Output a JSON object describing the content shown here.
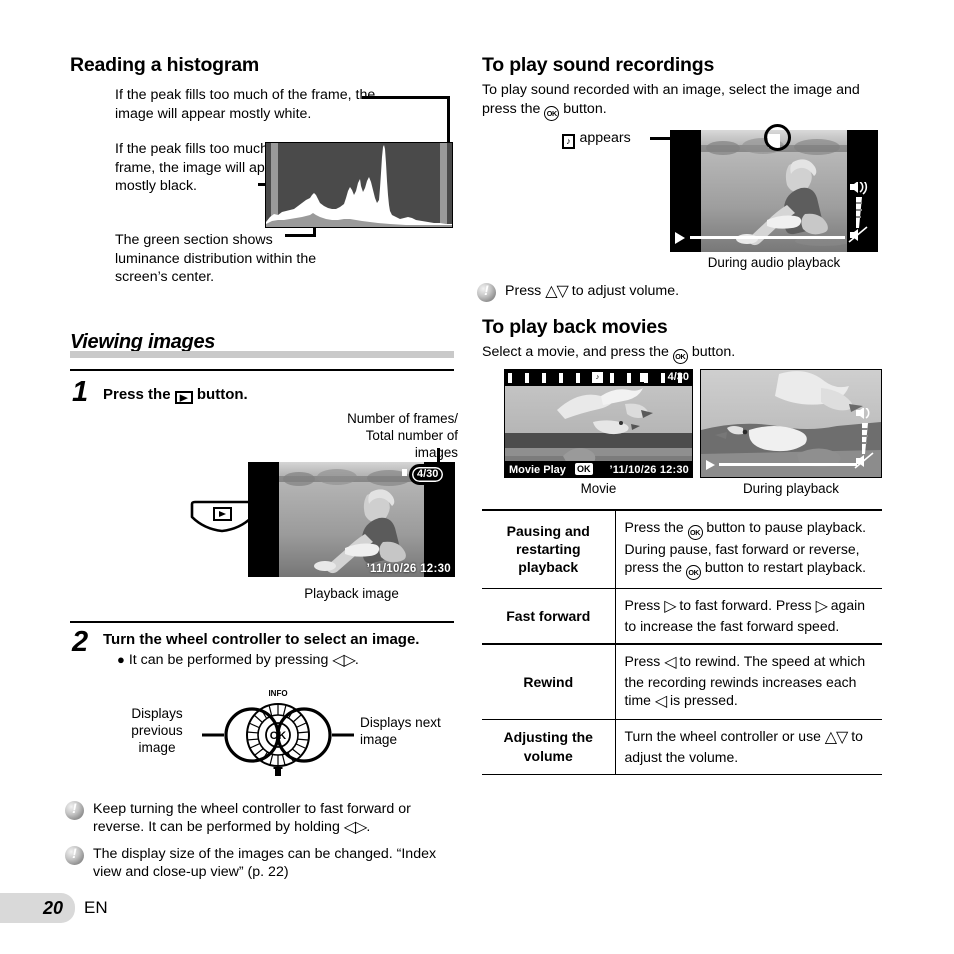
{
  "page": {
    "number": "20",
    "language": "EN"
  },
  "left_column": {
    "histogram_section": {
      "heading": "Reading a histogram",
      "callout_top": "If the peak fills too much of the frame, the image will appear mostly white.",
      "callout_mid": "If the peak fills too much of the frame, the image will appear mostly black.",
      "callout_bottom": "The green section shows luminance distribution within the screen’s center."
    },
    "viewing_section": {
      "heading": "Viewing images",
      "step1": {
        "number": "1",
        "text_before": "Press the",
        "icon": "playback-icon",
        "text_after": "button."
      },
      "frames_label": "Number of frames/\nTotal number of images",
      "playback_caption": "Playback image",
      "playback_screen": {
        "frame_counter": "4/30",
        "datetime": "’11/10/26  12:30"
      },
      "step2": {
        "number": "2",
        "text": "Turn the wheel controller to select an image.",
        "bullet": "It can be performed by pressing",
        "bullet_icon": "left-right-arrows",
        "bullet_after": "."
      },
      "wheel": {
        "left_label": "Displays\nprevious\nimage",
        "right_label": "Displays next\nimage",
        "info_label": "INFO",
        "ok_label": "OK"
      },
      "notes": [
        {
          "text_a": "Keep turning the wheel controller to fast forward or reverse. It can be performed by holding",
          "icon": "left-right-arrows",
          "text_b": "."
        },
        {
          "text_a": "The display size of the images can be changed. “Index view and close-up view” (p. 22)",
          "icon": "",
          "text_b": ""
        }
      ]
    }
  },
  "right_column": {
    "sound_section": {
      "heading": "To play sound recordings",
      "body_a": "To play sound recorded with an image, select the image and press the",
      "body_icon": "ok-button",
      "body_b": "button.",
      "appears_icon": "sound-note-icon",
      "appears_label": "appears",
      "caption": "During audio playback",
      "note": {
        "text_a": "Press",
        "icon": "up-down-arrows",
        "text_b": "to adjust volume."
      }
    },
    "movies_section": {
      "heading": "To play back movies",
      "body_a": "Select a movie, and press the",
      "body_icon": "ok-button",
      "body_b": "button.",
      "caption_left": "Movie",
      "caption_right": "During playback",
      "movie_screen": {
        "label": "Movie Play",
        "ok_badge": "OK",
        "frame_counter": "4/30",
        "datetime": "’11/10/26  12:30"
      }
    },
    "table": {
      "rows": [
        {
          "key": "Pausing and restarting playback",
          "value_parts": [
            {
              "t": "Press the "
            },
            {
              "icon": "ok-button"
            },
            {
              "t": " button to pause playback. During pause, fast forward or reverse, press the "
            },
            {
              "icon": "ok-button"
            },
            {
              "t": " button to restart playback."
            }
          ]
        },
        {
          "key": "Fast forward",
          "value_parts": [
            {
              "t": "Press "
            },
            {
              "icon": "right-arrow"
            },
            {
              "t": " to fast forward. Press "
            },
            {
              "icon": "right-arrow"
            },
            {
              "t": " again to increase the fast forward speed."
            }
          ]
        },
        {
          "key": "Rewind",
          "value_parts": [
            {
              "t": "Press "
            },
            {
              "icon": "left-arrow"
            },
            {
              "t": " to rewind. The speed at which the recording rewinds increases each time "
            },
            {
              "icon": "left-arrow"
            },
            {
              "t": " is pressed."
            }
          ]
        },
        {
          "key": "Adjusting the volume",
          "value_parts": [
            {
              "t": "Turn the wheel controller or use "
            },
            {
              "icon": "up-down-arrows"
            },
            {
              "t": " to adjust the volume."
            }
          ]
        }
      ]
    }
  },
  "colors": {
    "rule_gray": "#c9c9c9",
    "footer_tab": "#d9d9d9",
    "hist_bg": "#4a4a4a",
    "hist_band": "#9a9a9a"
  }
}
